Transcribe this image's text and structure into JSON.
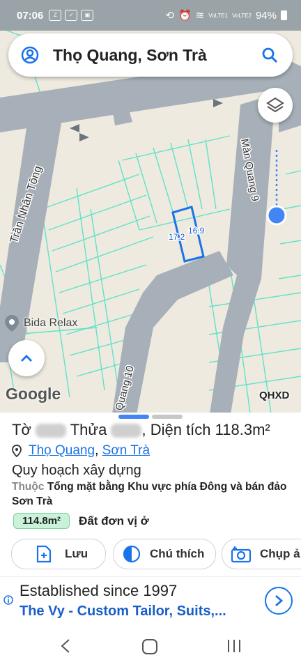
{
  "status": {
    "time": "07:06",
    "battery": "94%",
    "net1": "VoLTE1",
    "net2": "VoLTE2"
  },
  "search": {
    "title": "Thọ Quang, Sơn Trà"
  },
  "map": {
    "streets": [
      "Trần Nhân Tông",
      "Mân Quang 9",
      "Quang 10"
    ],
    "parcel_labels": [
      "17.2",
      "16.9"
    ],
    "poi": "Bida Relax",
    "google_logo": "Google",
    "provider": "QHXD"
  },
  "sheet": {
    "title_prefix": "Tờ",
    "title_mid": "Thửa",
    "area_label": ", Diện tích",
    "area_value": "118.3m²",
    "location_ward": "Thọ Quang",
    "location_sep": ",",
    "location_district": "Sơn Trà",
    "planning_title": "Quy hoạch xây dựng",
    "planning_prefix": "Thuộc",
    "planning_text": "Tổng mặt bằng Khu vực phía Đông và bán đảo Sơn Trà",
    "land_chip": "114.8m²",
    "land_type": "Đất đơn vị ở",
    "buttons": {
      "save": "Lưu",
      "legend": "Chú thích",
      "capture": "Chụp ả"
    }
  },
  "ad": {
    "line1": "Established since 1997",
    "line2": "The Vy - Custom Tailor, Suits,..."
  },
  "colors": {
    "accent": "#1a73e8",
    "road": "#a7b0b8",
    "parcel": "#5fe2c8",
    "chip": "#c9f2d9"
  }
}
